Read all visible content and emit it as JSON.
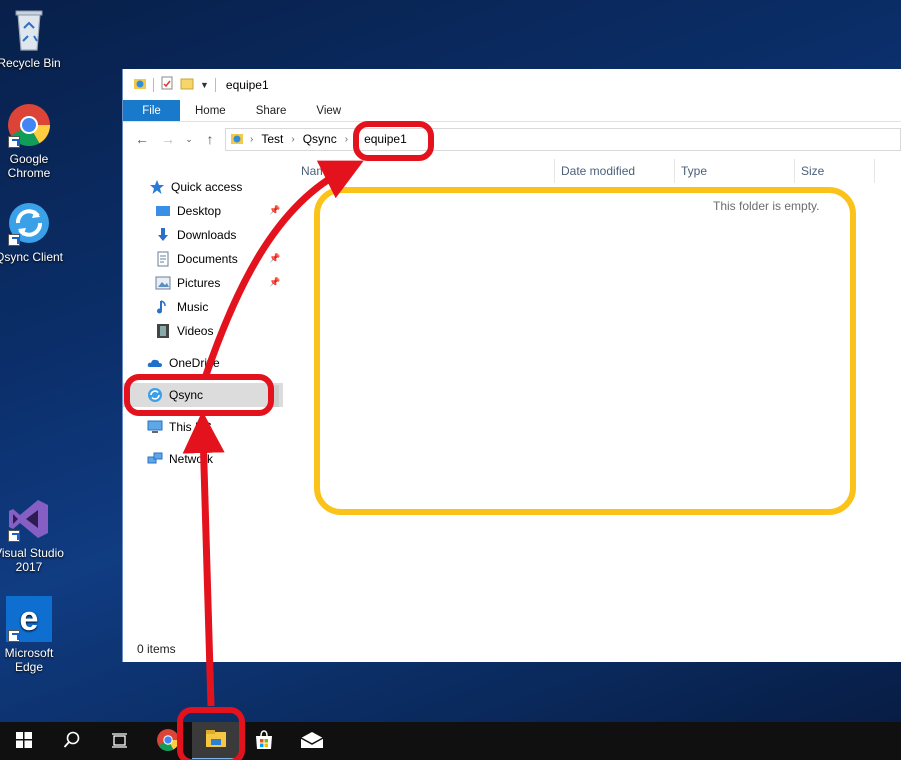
{
  "desktop": {
    "icons": [
      {
        "label": "Recycle Bin",
        "icon": "recycle-bin-icon"
      },
      {
        "label": "Google Chrome",
        "icon": "chrome-icon"
      },
      {
        "label": "Qsync Client",
        "icon": "qsync-icon"
      },
      {
        "label": "Visual Studio 2017",
        "icon": "visual-studio-icon"
      },
      {
        "label": "Microsoft Edge",
        "icon": "edge-icon"
      }
    ]
  },
  "explorer": {
    "title": "equipe1",
    "ribbon_tabs": [
      "File",
      "Home",
      "Share",
      "View"
    ],
    "address": {
      "root_icon": "qsync-folder-icon",
      "crumbs": [
        "Test",
        "Qsync",
        "equipe1"
      ]
    },
    "nav": {
      "quick_access": "Quick access",
      "items": [
        {
          "label": "Desktop",
          "icon": "desktop-folder-icon",
          "pinned": true
        },
        {
          "label": "Downloads",
          "icon": "downloads-icon",
          "pinned": false
        },
        {
          "label": "Documents",
          "icon": "documents-icon",
          "pinned": true
        },
        {
          "label": "Pictures",
          "icon": "pictures-icon",
          "pinned": true
        },
        {
          "label": "Music",
          "icon": "music-icon",
          "pinned": false
        },
        {
          "label": "Videos",
          "icon": "videos-icon",
          "pinned": false
        }
      ],
      "onedrive": "OneDrive",
      "qsync": "Qsync",
      "this_pc": "This PC",
      "network": "Network"
    },
    "columns": [
      "Name",
      "Date modified",
      "Type",
      "Size"
    ],
    "empty_message": "This folder is empty.",
    "status": "0 items"
  },
  "taskbar": {
    "items": [
      "start-icon",
      "search-icon",
      "task-view-icon",
      "chrome-icon",
      "file-explorer-icon",
      "store-icon",
      "mail-icon"
    ],
    "active": "file-explorer-icon"
  },
  "annotations": {
    "highlight_red": "#e3121d",
    "highlight_yellow": "#fbc319"
  }
}
